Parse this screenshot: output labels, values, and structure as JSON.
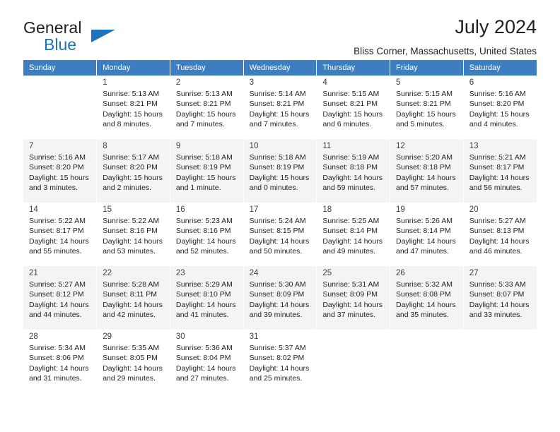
{
  "brand": {
    "name_primary": "General",
    "name_secondary": "Blue",
    "triangle_icon": "triangle-icon"
  },
  "header": {
    "title": "July 2024",
    "subtitle": "Bliss Corner, Massachusetts, United States"
  },
  "colors": {
    "header_row_bg": "#3c7ebf",
    "brand_blue": "#1b75bb",
    "alt_row_bg": "#f4f4f4",
    "text": "#231f20"
  },
  "weekdays": [
    "Sunday",
    "Monday",
    "Tuesday",
    "Wednesday",
    "Thursday",
    "Friday",
    "Saturday"
  ],
  "weeks": [
    [
      {
        "day": "",
        "sunrise": "",
        "sunset": "",
        "daylight_1": "",
        "daylight_2": ""
      },
      {
        "day": "1",
        "sunrise": "Sunrise: 5:13 AM",
        "sunset": "Sunset: 8:21 PM",
        "daylight_1": "Daylight: 15 hours",
        "daylight_2": "and 8 minutes."
      },
      {
        "day": "2",
        "sunrise": "Sunrise: 5:13 AM",
        "sunset": "Sunset: 8:21 PM",
        "daylight_1": "Daylight: 15 hours",
        "daylight_2": "and 7 minutes."
      },
      {
        "day": "3",
        "sunrise": "Sunrise: 5:14 AM",
        "sunset": "Sunset: 8:21 PM",
        "daylight_1": "Daylight: 15 hours",
        "daylight_2": "and 7 minutes."
      },
      {
        "day": "4",
        "sunrise": "Sunrise: 5:15 AM",
        "sunset": "Sunset: 8:21 PM",
        "daylight_1": "Daylight: 15 hours",
        "daylight_2": "and 6 minutes."
      },
      {
        "day": "5",
        "sunrise": "Sunrise: 5:15 AM",
        "sunset": "Sunset: 8:21 PM",
        "daylight_1": "Daylight: 15 hours",
        "daylight_2": "and 5 minutes."
      },
      {
        "day": "6",
        "sunrise": "Sunrise: 5:16 AM",
        "sunset": "Sunset: 8:20 PM",
        "daylight_1": "Daylight: 15 hours",
        "daylight_2": "and 4 minutes."
      }
    ],
    [
      {
        "day": "7",
        "sunrise": "Sunrise: 5:16 AM",
        "sunset": "Sunset: 8:20 PM",
        "daylight_1": "Daylight: 15 hours",
        "daylight_2": "and 3 minutes."
      },
      {
        "day": "8",
        "sunrise": "Sunrise: 5:17 AM",
        "sunset": "Sunset: 8:20 PM",
        "daylight_1": "Daylight: 15 hours",
        "daylight_2": "and 2 minutes."
      },
      {
        "day": "9",
        "sunrise": "Sunrise: 5:18 AM",
        "sunset": "Sunset: 8:19 PM",
        "daylight_1": "Daylight: 15 hours",
        "daylight_2": "and 1 minute."
      },
      {
        "day": "10",
        "sunrise": "Sunrise: 5:18 AM",
        "sunset": "Sunset: 8:19 PM",
        "daylight_1": "Daylight: 15 hours",
        "daylight_2": "and 0 minutes."
      },
      {
        "day": "11",
        "sunrise": "Sunrise: 5:19 AM",
        "sunset": "Sunset: 8:18 PM",
        "daylight_1": "Daylight: 14 hours",
        "daylight_2": "and 59 minutes."
      },
      {
        "day": "12",
        "sunrise": "Sunrise: 5:20 AM",
        "sunset": "Sunset: 8:18 PM",
        "daylight_1": "Daylight: 14 hours",
        "daylight_2": "and 57 minutes."
      },
      {
        "day": "13",
        "sunrise": "Sunrise: 5:21 AM",
        "sunset": "Sunset: 8:17 PM",
        "daylight_1": "Daylight: 14 hours",
        "daylight_2": "and 56 minutes."
      }
    ],
    [
      {
        "day": "14",
        "sunrise": "Sunrise: 5:22 AM",
        "sunset": "Sunset: 8:17 PM",
        "daylight_1": "Daylight: 14 hours",
        "daylight_2": "and 55 minutes."
      },
      {
        "day": "15",
        "sunrise": "Sunrise: 5:22 AM",
        "sunset": "Sunset: 8:16 PM",
        "daylight_1": "Daylight: 14 hours",
        "daylight_2": "and 53 minutes."
      },
      {
        "day": "16",
        "sunrise": "Sunrise: 5:23 AM",
        "sunset": "Sunset: 8:16 PM",
        "daylight_1": "Daylight: 14 hours",
        "daylight_2": "and 52 minutes."
      },
      {
        "day": "17",
        "sunrise": "Sunrise: 5:24 AM",
        "sunset": "Sunset: 8:15 PM",
        "daylight_1": "Daylight: 14 hours",
        "daylight_2": "and 50 minutes."
      },
      {
        "day": "18",
        "sunrise": "Sunrise: 5:25 AM",
        "sunset": "Sunset: 8:14 PM",
        "daylight_1": "Daylight: 14 hours",
        "daylight_2": "and 49 minutes."
      },
      {
        "day": "19",
        "sunrise": "Sunrise: 5:26 AM",
        "sunset": "Sunset: 8:14 PM",
        "daylight_1": "Daylight: 14 hours",
        "daylight_2": "and 47 minutes."
      },
      {
        "day": "20",
        "sunrise": "Sunrise: 5:27 AM",
        "sunset": "Sunset: 8:13 PM",
        "daylight_1": "Daylight: 14 hours",
        "daylight_2": "and 46 minutes."
      }
    ],
    [
      {
        "day": "21",
        "sunrise": "Sunrise: 5:27 AM",
        "sunset": "Sunset: 8:12 PM",
        "daylight_1": "Daylight: 14 hours",
        "daylight_2": "and 44 minutes."
      },
      {
        "day": "22",
        "sunrise": "Sunrise: 5:28 AM",
        "sunset": "Sunset: 8:11 PM",
        "daylight_1": "Daylight: 14 hours",
        "daylight_2": "and 42 minutes."
      },
      {
        "day": "23",
        "sunrise": "Sunrise: 5:29 AM",
        "sunset": "Sunset: 8:10 PM",
        "daylight_1": "Daylight: 14 hours",
        "daylight_2": "and 41 minutes."
      },
      {
        "day": "24",
        "sunrise": "Sunrise: 5:30 AM",
        "sunset": "Sunset: 8:09 PM",
        "daylight_1": "Daylight: 14 hours",
        "daylight_2": "and 39 minutes."
      },
      {
        "day": "25",
        "sunrise": "Sunrise: 5:31 AM",
        "sunset": "Sunset: 8:09 PM",
        "daylight_1": "Daylight: 14 hours",
        "daylight_2": "and 37 minutes."
      },
      {
        "day": "26",
        "sunrise": "Sunrise: 5:32 AM",
        "sunset": "Sunset: 8:08 PM",
        "daylight_1": "Daylight: 14 hours",
        "daylight_2": "and 35 minutes."
      },
      {
        "day": "27",
        "sunrise": "Sunrise: 5:33 AM",
        "sunset": "Sunset: 8:07 PM",
        "daylight_1": "Daylight: 14 hours",
        "daylight_2": "and 33 minutes."
      }
    ],
    [
      {
        "day": "28",
        "sunrise": "Sunrise: 5:34 AM",
        "sunset": "Sunset: 8:06 PM",
        "daylight_1": "Daylight: 14 hours",
        "daylight_2": "and 31 minutes."
      },
      {
        "day": "29",
        "sunrise": "Sunrise: 5:35 AM",
        "sunset": "Sunset: 8:05 PM",
        "daylight_1": "Daylight: 14 hours",
        "daylight_2": "and 29 minutes."
      },
      {
        "day": "30",
        "sunrise": "Sunrise: 5:36 AM",
        "sunset": "Sunset: 8:04 PM",
        "daylight_1": "Daylight: 14 hours",
        "daylight_2": "and 27 minutes."
      },
      {
        "day": "31",
        "sunrise": "Sunrise: 5:37 AM",
        "sunset": "Sunset: 8:02 PM",
        "daylight_1": "Daylight: 14 hours",
        "daylight_2": "and 25 minutes."
      },
      {
        "day": "",
        "sunrise": "",
        "sunset": "",
        "daylight_1": "",
        "daylight_2": ""
      },
      {
        "day": "",
        "sunrise": "",
        "sunset": "",
        "daylight_1": "",
        "daylight_2": ""
      },
      {
        "day": "",
        "sunrise": "",
        "sunset": "",
        "daylight_1": "",
        "daylight_2": ""
      }
    ]
  ]
}
